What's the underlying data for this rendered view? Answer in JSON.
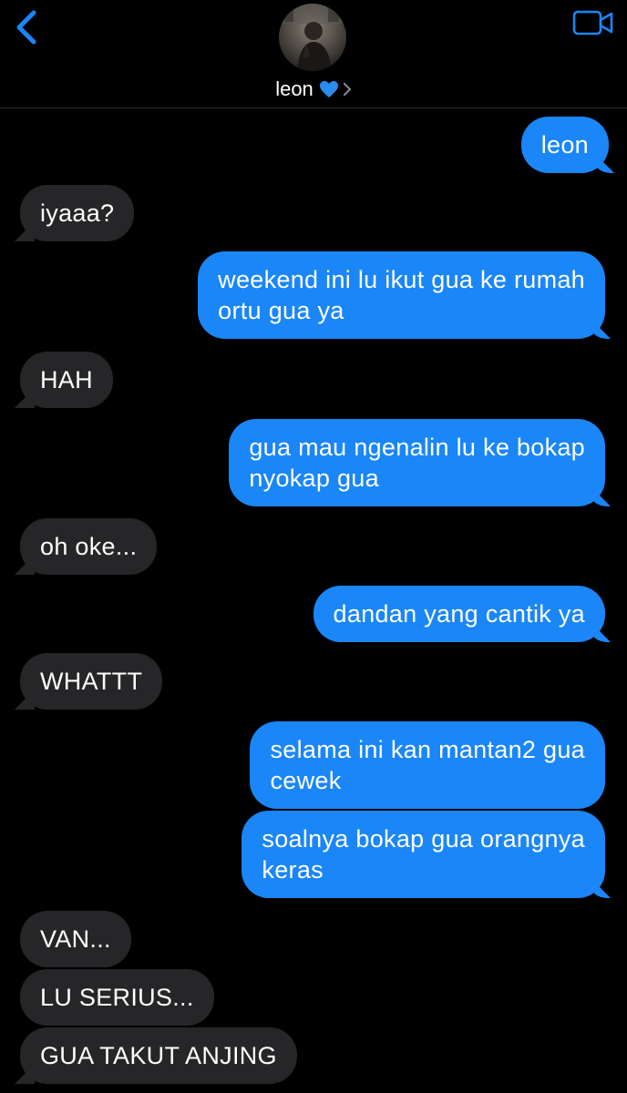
{
  "header": {
    "contact_name": "leon",
    "heart_emoji": "💙",
    "accent_color": "#1a86f8",
    "back_icon": "chevron-left-icon",
    "video_icon": "video-camera-icon"
  },
  "colors": {
    "background": "#000000",
    "outgoing_bubble": "#1a86f8",
    "incoming_bubble": "#262628",
    "text": "#ffffff"
  },
  "messages": [
    {
      "direction": "outgoing",
      "lines": [
        "leon"
      ]
    },
    {
      "direction": "incoming",
      "lines": [
        "iyaaa?"
      ]
    },
    {
      "direction": "outgoing",
      "lines": [
        "weekend ini lu ikut gua ke rumah",
        "ortu gua ya"
      ]
    },
    {
      "direction": "incoming",
      "lines": [
        "HAH"
      ]
    },
    {
      "direction": "outgoing",
      "lines": [
        "gua mau ngenalin lu ke bokap",
        "nyokap gua"
      ]
    },
    {
      "direction": "incoming",
      "lines": [
        "oh oke..."
      ]
    },
    {
      "direction": "outgoing",
      "lines": [
        "dandan yang cantik ya"
      ]
    },
    {
      "direction": "incoming",
      "lines": [
        "WHATTT"
      ]
    },
    {
      "direction": "outgoing",
      "lines": [
        "selama ini kan mantan2 gua",
        "cewek"
      ]
    },
    {
      "direction": "outgoing",
      "lines": [
        "soalnya bokap gua orangnya",
        "keras"
      ]
    },
    {
      "direction": "incoming",
      "lines": [
        "VAN..."
      ]
    },
    {
      "direction": "incoming",
      "lines": [
        "LU SERIUS..."
      ]
    },
    {
      "direction": "incoming",
      "lines": [
        "GUA TAKUT ANJING"
      ]
    }
  ]
}
